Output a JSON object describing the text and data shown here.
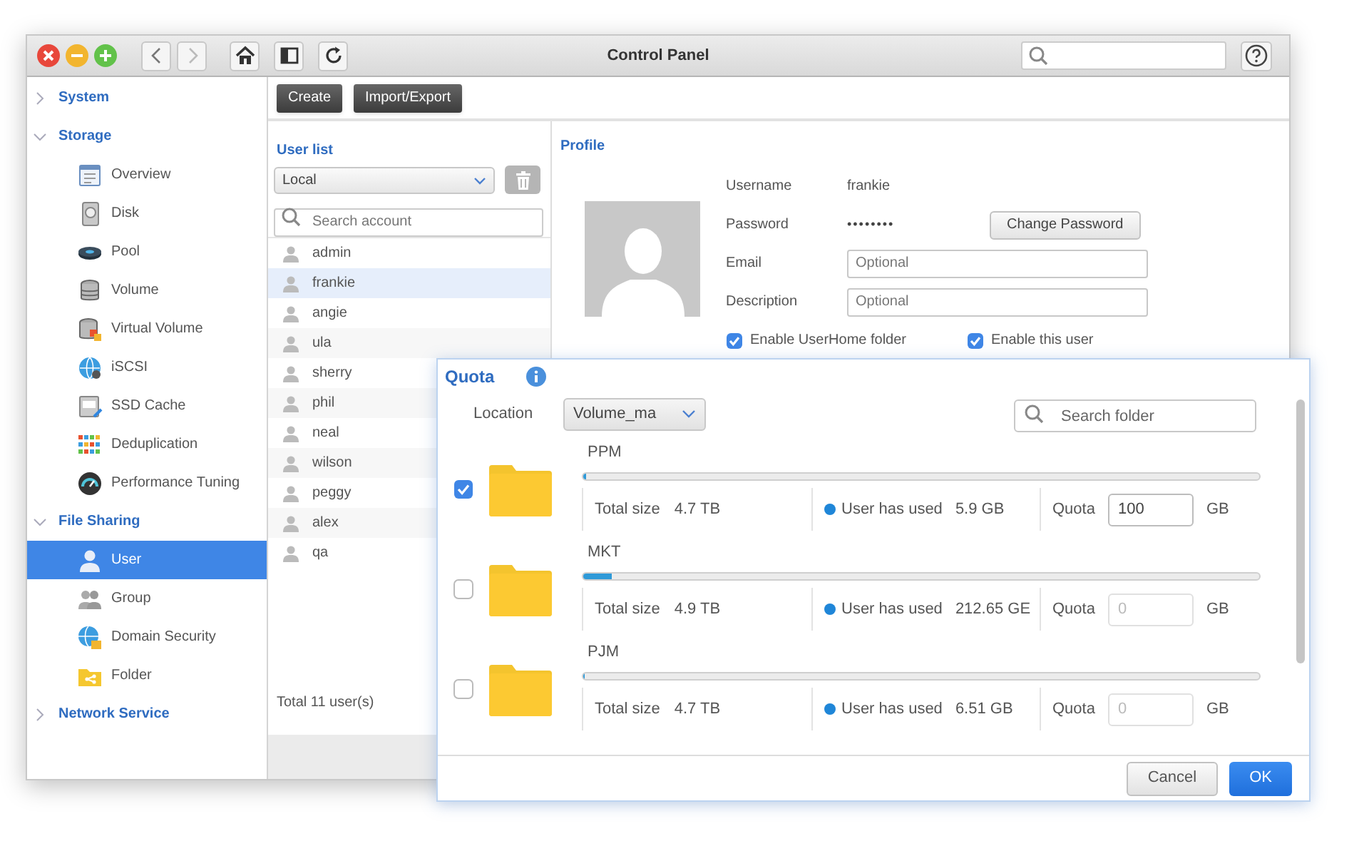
{
  "window": {
    "title": "Control Panel"
  },
  "toolbar": {
    "buttons": [
      "Create",
      "Import/Export"
    ]
  },
  "sidebar": {
    "groups": [
      {
        "label": "System",
        "expanded": false
      },
      {
        "label": "Storage",
        "expanded": true,
        "items": [
          {
            "label": "Overview",
            "selected": false
          },
          {
            "label": "Disk",
            "selected": false
          },
          {
            "label": "Pool",
            "selected": false
          },
          {
            "label": "Volume",
            "selected": false
          },
          {
            "label": "Virtual Volume",
            "selected": false
          },
          {
            "label": "iSCSI",
            "selected": false
          },
          {
            "label": "SSD Cache",
            "selected": false
          },
          {
            "label": "Deduplication",
            "selected": false
          },
          {
            "label": "Performance Tuning",
            "selected": false
          }
        ]
      },
      {
        "label": "File Sharing",
        "expanded": true,
        "items": [
          {
            "label": "User",
            "selected": true
          },
          {
            "label": "Group",
            "selected": false
          },
          {
            "label": "Domain Security",
            "selected": false
          },
          {
            "label": "Folder",
            "selected": false
          }
        ]
      },
      {
        "label": "Network Service",
        "expanded": false
      }
    ]
  },
  "user_list": {
    "title": "User list",
    "filter": "Local",
    "search": {
      "placeholder": "Search account"
    },
    "users": [
      {
        "name": "admin",
        "selected": false
      },
      {
        "name": "frankie",
        "selected": true
      },
      {
        "name": "angie",
        "selected": false
      },
      {
        "name": "ula",
        "selected": false
      },
      {
        "name": "sherry",
        "selected": false
      },
      {
        "name": "phil",
        "selected": false
      },
      {
        "name": "neal",
        "selected": false
      },
      {
        "name": "wilson",
        "selected": false
      },
      {
        "name": "peggy",
        "selected": false
      },
      {
        "name": "alex",
        "selected": false
      },
      {
        "name": "qa",
        "selected": false
      }
    ],
    "total": "Total 11 user(s)"
  },
  "profile": {
    "title": "Profile",
    "username_label": "Username",
    "username": "frankie",
    "password_label": "Password",
    "password": "••••••••",
    "change_password": "Change Password",
    "email_label": "Email",
    "email": {
      "placeholder": "Optional"
    },
    "description_label": "Description",
    "description": {
      "placeholder": "Optional"
    },
    "options": [
      {
        "label": "Enable UserHome folder",
        "checked": true
      },
      {
        "label": "Enable this user",
        "checked": true
      }
    ]
  },
  "quota_dialog": {
    "title": "Quota",
    "location_label": "Location",
    "location": "Volume_ma",
    "search": {
      "placeholder": "Search folder"
    },
    "folders": [
      {
        "name": "PPM",
        "checked": true,
        "level": 0.004,
        "total_label": "Total size",
        "total": "4.7 TB",
        "used_label": "User has used",
        "used": "5.9 GB",
        "quota_label": "Quota",
        "quota": "100",
        "quota_disabled": false,
        "unit": "GB"
      },
      {
        "name": "MKT",
        "checked": false,
        "level": 0.043,
        "total_label": "Total size",
        "total": "4.9 TB",
        "used_label": "User has used",
        "used": "212.65 GE",
        "quota_label": "Quota",
        "quota": "0",
        "quota_disabled": true,
        "unit": "GB"
      },
      {
        "name": "PJM",
        "checked": false,
        "level": 0.002,
        "total_label": "Total size",
        "total": "4.7 TB",
        "used_label": "User has used",
        "used": "6.51 GB",
        "quota_label": "Quota",
        "quota": "0",
        "quota_disabled": true,
        "unit": "GB"
      }
    ],
    "buttons": [
      "Cancel",
      "OK"
    ]
  }
}
